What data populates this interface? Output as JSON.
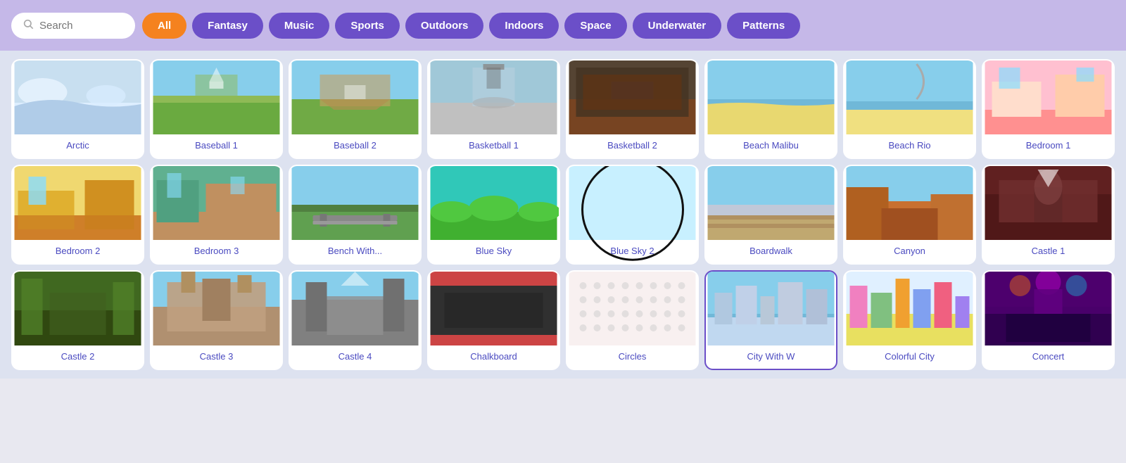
{
  "header": {
    "search_placeholder": "Search",
    "filters": [
      {
        "id": "all",
        "label": "All",
        "active": true
      },
      {
        "id": "fantasy",
        "label": "Fantasy",
        "active": false
      },
      {
        "id": "music",
        "label": "Music",
        "active": false
      },
      {
        "id": "sports",
        "label": "Sports",
        "active": false
      },
      {
        "id": "outdoors",
        "label": "Outdoors",
        "active": false
      },
      {
        "id": "indoors",
        "label": "Indoors",
        "active": false
      },
      {
        "id": "space",
        "label": "Space",
        "active": false
      },
      {
        "id": "underwater",
        "label": "Underwater",
        "active": false
      },
      {
        "id": "patterns",
        "label": "Patterns",
        "active": false
      }
    ]
  },
  "rows": [
    {
      "items": [
        {
          "id": "arctic",
          "label": "Arctic",
          "thumb": "arctic",
          "selected": false,
          "circled": false
        },
        {
          "id": "baseball1",
          "label": "Baseball 1",
          "thumb": "baseball1",
          "selected": false,
          "circled": false
        },
        {
          "id": "baseball2",
          "label": "Baseball 2",
          "thumb": "baseball2",
          "selected": false,
          "circled": false
        },
        {
          "id": "basketball1",
          "label": "Basketball 1",
          "thumb": "basketball1",
          "selected": false,
          "circled": false
        },
        {
          "id": "basketball2",
          "label": "Basketball 2",
          "thumb": "basketball2",
          "selected": false,
          "circled": false
        },
        {
          "id": "beachmalibu",
          "label": "Beach Malibu",
          "thumb": "beachmalibu",
          "selected": false,
          "circled": false
        },
        {
          "id": "beachrio",
          "label": "Beach Rio",
          "thumb": "beachrio",
          "selected": false,
          "circled": false
        },
        {
          "id": "bedroom1",
          "label": "Bedroom 1",
          "thumb": "bedroom1",
          "selected": false,
          "circled": false
        }
      ]
    },
    {
      "items": [
        {
          "id": "bedroom2",
          "label": "Bedroom 2",
          "thumb": "bedroom2",
          "selected": false,
          "circled": false
        },
        {
          "id": "bedroom3",
          "label": "Bedroom 3",
          "thumb": "bedroom3",
          "selected": false,
          "circled": false
        },
        {
          "id": "benchwith",
          "label": "Bench With...",
          "thumb": "benchwith",
          "selected": false,
          "circled": false
        },
        {
          "id": "bluesky",
          "label": "Blue Sky",
          "thumb": "bluesky",
          "selected": false,
          "circled": false
        },
        {
          "id": "bluesky2",
          "label": "Blue Sky 2",
          "thumb": "bluesky2",
          "selected": false,
          "circled": true
        },
        {
          "id": "boardwalk",
          "label": "Boardwalk",
          "thumb": "boardwalk",
          "selected": false,
          "circled": false
        },
        {
          "id": "canyon",
          "label": "Canyon",
          "thumb": "canyon",
          "selected": false,
          "circled": false
        },
        {
          "id": "castle1",
          "label": "Castle 1",
          "thumb": "castle1",
          "selected": false,
          "circled": false
        }
      ]
    },
    {
      "items": [
        {
          "id": "castle2",
          "label": "Castle 2",
          "thumb": "castle2",
          "selected": false,
          "circled": false
        },
        {
          "id": "castle3",
          "label": "Castle 3",
          "thumb": "castle3",
          "selected": false,
          "circled": false
        },
        {
          "id": "castle4",
          "label": "Castle 4",
          "thumb": "castle4",
          "selected": false,
          "circled": false
        },
        {
          "id": "chalkboard",
          "label": "Chalkboard",
          "thumb": "chalkboard",
          "selected": false,
          "circled": false
        },
        {
          "id": "circles",
          "label": "Circles",
          "thumb": "circles",
          "selected": false,
          "circled": false
        },
        {
          "id": "citywithw",
          "label": "City With W",
          "thumb": "citywithw",
          "selected": true,
          "circled": false
        },
        {
          "id": "colorfucity",
          "label": "Colorful City",
          "thumb": "colorfucity",
          "selected": false,
          "circled": false
        },
        {
          "id": "concert",
          "label": "Concert",
          "thumb": "concert",
          "selected": false,
          "circled": false
        }
      ]
    }
  ]
}
